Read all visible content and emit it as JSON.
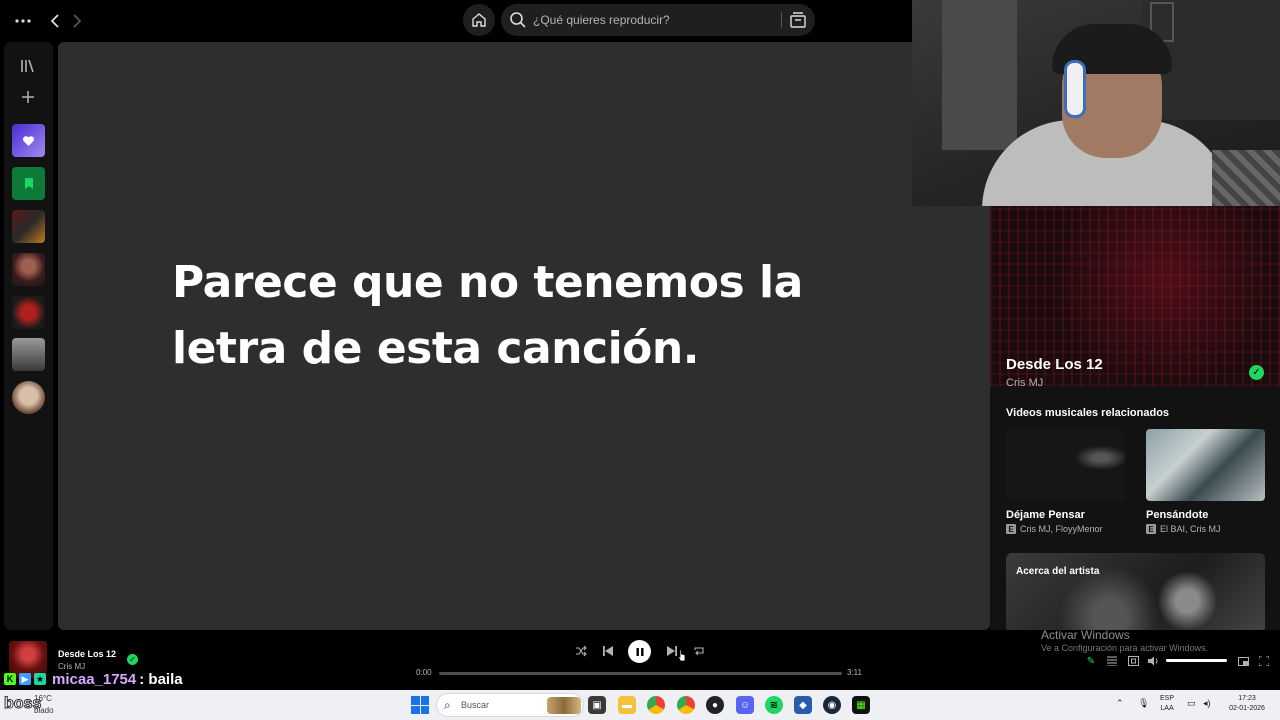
{
  "search": {
    "placeholder": "¿Qué quieres reproducir?"
  },
  "main": {
    "lyrics_message": "Parece que no tenemos la letra de esta canción."
  },
  "now_playing": {
    "title": "Desde Los 12",
    "artist": "Cris MJ",
    "saved": true,
    "elapsed": "0:00",
    "duration": "3:11",
    "progress_fraction": 0.0,
    "volume_fraction": 1.0
  },
  "right_panel": {
    "title": "Desde Los 12",
    "artist": "Cris MJ",
    "related_videos_heading": "Videos musicales relacionados",
    "videos": [
      {
        "title": "Déjame Pensar",
        "artists": "Cris MJ, FloyyMenor",
        "explicit_label": "E"
      },
      {
        "title": "Pensándote",
        "artists": "El BAI, Cris MJ",
        "explicit_label": "E"
      }
    ],
    "about_artist": "Acerca del artista"
  },
  "windows_watermark": {
    "title": "Activar Windows",
    "subtitle": "Ve a Configuración para activar Windows."
  },
  "chat": {
    "username": "micaa_1754",
    "message": ": baila"
  },
  "taskbar": {
    "overlay_text": "boss",
    "temperature": "16°C",
    "condition_partial": "blado",
    "search_label": "Buscar",
    "lang_primary": "ESP",
    "lang_secondary": "LAA",
    "time": "17:23",
    "date": "02-01-2026"
  },
  "colors": {
    "spotify_green": "#1ed760",
    "main_bg": "#2e2e2e",
    "panel_bg": "#121212",
    "chat_username": "#d6a8ff",
    "windows_blue": "#1a73e8"
  },
  "icons": {
    "top": [
      "more-icon",
      "back-icon",
      "forward-icon",
      "home-icon",
      "search-icon",
      "browse-icon"
    ],
    "sidebar": [
      "library-icon",
      "plus-icon",
      "liked-songs-icon",
      "saved-episodes-icon"
    ],
    "player": [
      "shuffle-icon",
      "previous-icon",
      "pause-icon",
      "next-icon",
      "repeat-icon"
    ]
  }
}
